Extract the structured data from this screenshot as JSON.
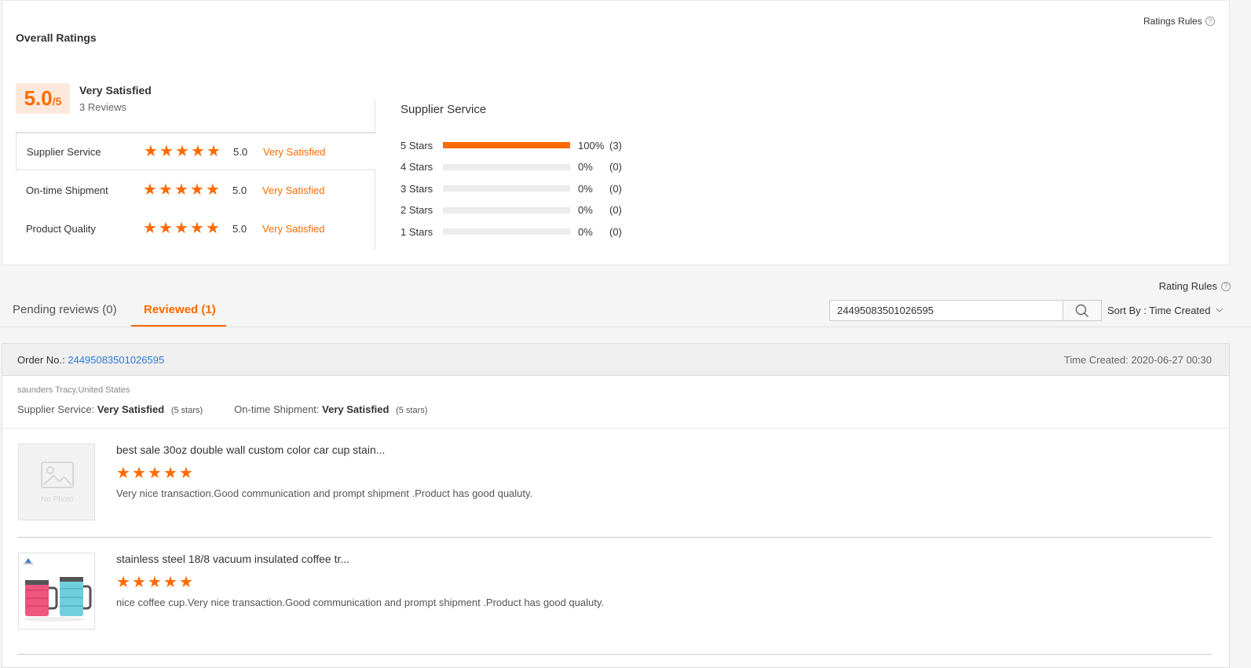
{
  "overall": {
    "title": "Overall Ratings",
    "rules_link": "Ratings Rules",
    "score": "5.0",
    "score_max": "/5",
    "summary_label": "Very Satisfied",
    "review_count": "3 Reviews",
    "metrics": [
      {
        "name": "Supplier Service",
        "stars": 5,
        "score": "5.0",
        "label": "Very Satisfied"
      },
      {
        "name": "On-time Shipment",
        "stars": 5,
        "score": "5.0",
        "label": "Very Satisfied"
      },
      {
        "name": "Product Quality",
        "stars": 5,
        "score": "5.0",
        "label": "Very Satisfied"
      }
    ],
    "distribution": {
      "title": "Supplier Service",
      "rows": [
        {
          "label": "5 Stars",
          "fraction": 1.0,
          "pct": "100%",
          "count": "(3)"
        },
        {
          "label": "4 Stars",
          "fraction": 0,
          "pct": "0%",
          "count": "(0)"
        },
        {
          "label": "3 Stars",
          "fraction": 0,
          "pct": "0%",
          "count": "(0)"
        },
        {
          "label": "2 Stars",
          "fraction": 0,
          "pct": "0%",
          "count": "(0)"
        },
        {
          "label": "1 Stars",
          "fraction": 0,
          "pct": "0%",
          "count": "(0)"
        }
      ]
    }
  },
  "reviews": {
    "rules_link": "Rating Rules",
    "tabs": [
      {
        "label": "Pending reviews (0)",
        "active": false
      },
      {
        "label": "Reviewed (1)",
        "active": true
      }
    ],
    "search_value": "24495083501026595",
    "sort_label": "Sort By : Time Created"
  },
  "order": {
    "order_no_label": "Order No.:",
    "order_no": "24495083501026595",
    "time_created": "Time Created: 2020-06-27 00:30",
    "buyer": "saunders Tracy,United States",
    "supplier_service_label": "Supplier Service:",
    "supplier_service_value": "Very Satisfied",
    "supplier_service_stars": "(5 stars)",
    "shipment_label": "On-time Shipment:",
    "shipment_value": "Very Satisfied",
    "shipment_stars": "(5 stars)",
    "items": [
      {
        "title": "best sale 30oz double wall custom color car cup stain...",
        "stars": 5,
        "comment": "Very nice transaction.Good communication and prompt shipment .Product has good qualuty.",
        "image": "no-photo",
        "no_photo_text": "No Photo"
      },
      {
        "title": "stainless steel 18/8 vacuum insulated coffee tr...",
        "stars": 5,
        "comment": "nice coffee cup.Very nice transaction.Good communication and prompt shipment .Product has good qualuty.",
        "image": "mugs"
      }
    ]
  },
  "colors": {
    "accent": "#ff6a00",
    "link": "#2c7bd6"
  }
}
